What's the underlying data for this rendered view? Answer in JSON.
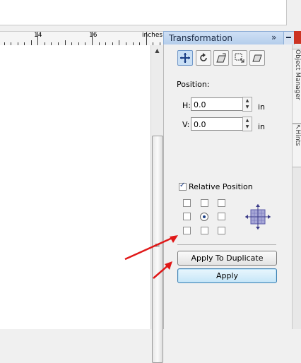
{
  "ruler": {
    "labels": [
      "14",
      "16"
    ],
    "units": "inches"
  },
  "docker": {
    "title": "Transformation",
    "expand_glyph": "»",
    "tool_icons": [
      "position-icon",
      "rotate-icon",
      "scale-icon",
      "size-icon",
      "skew-icon"
    ],
    "position": {
      "heading": "Position:",
      "h_label": "H:",
      "h_value": "0.0",
      "v_label": "V:",
      "v_value": "0.0",
      "unit": "in"
    },
    "relative_position": {
      "label": "Relative Position",
      "checked": true,
      "selected_anchor": "center"
    },
    "buttons": {
      "apply_to_duplicate": "Apply To Duplicate",
      "apply": "Apply"
    }
  },
  "side_tabs": [
    "Object Manager",
    "Hints"
  ],
  "colors": {
    "accent": "#c9dff5",
    "arrow": "#e01818",
    "docker_header": "#b4cdeb"
  }
}
